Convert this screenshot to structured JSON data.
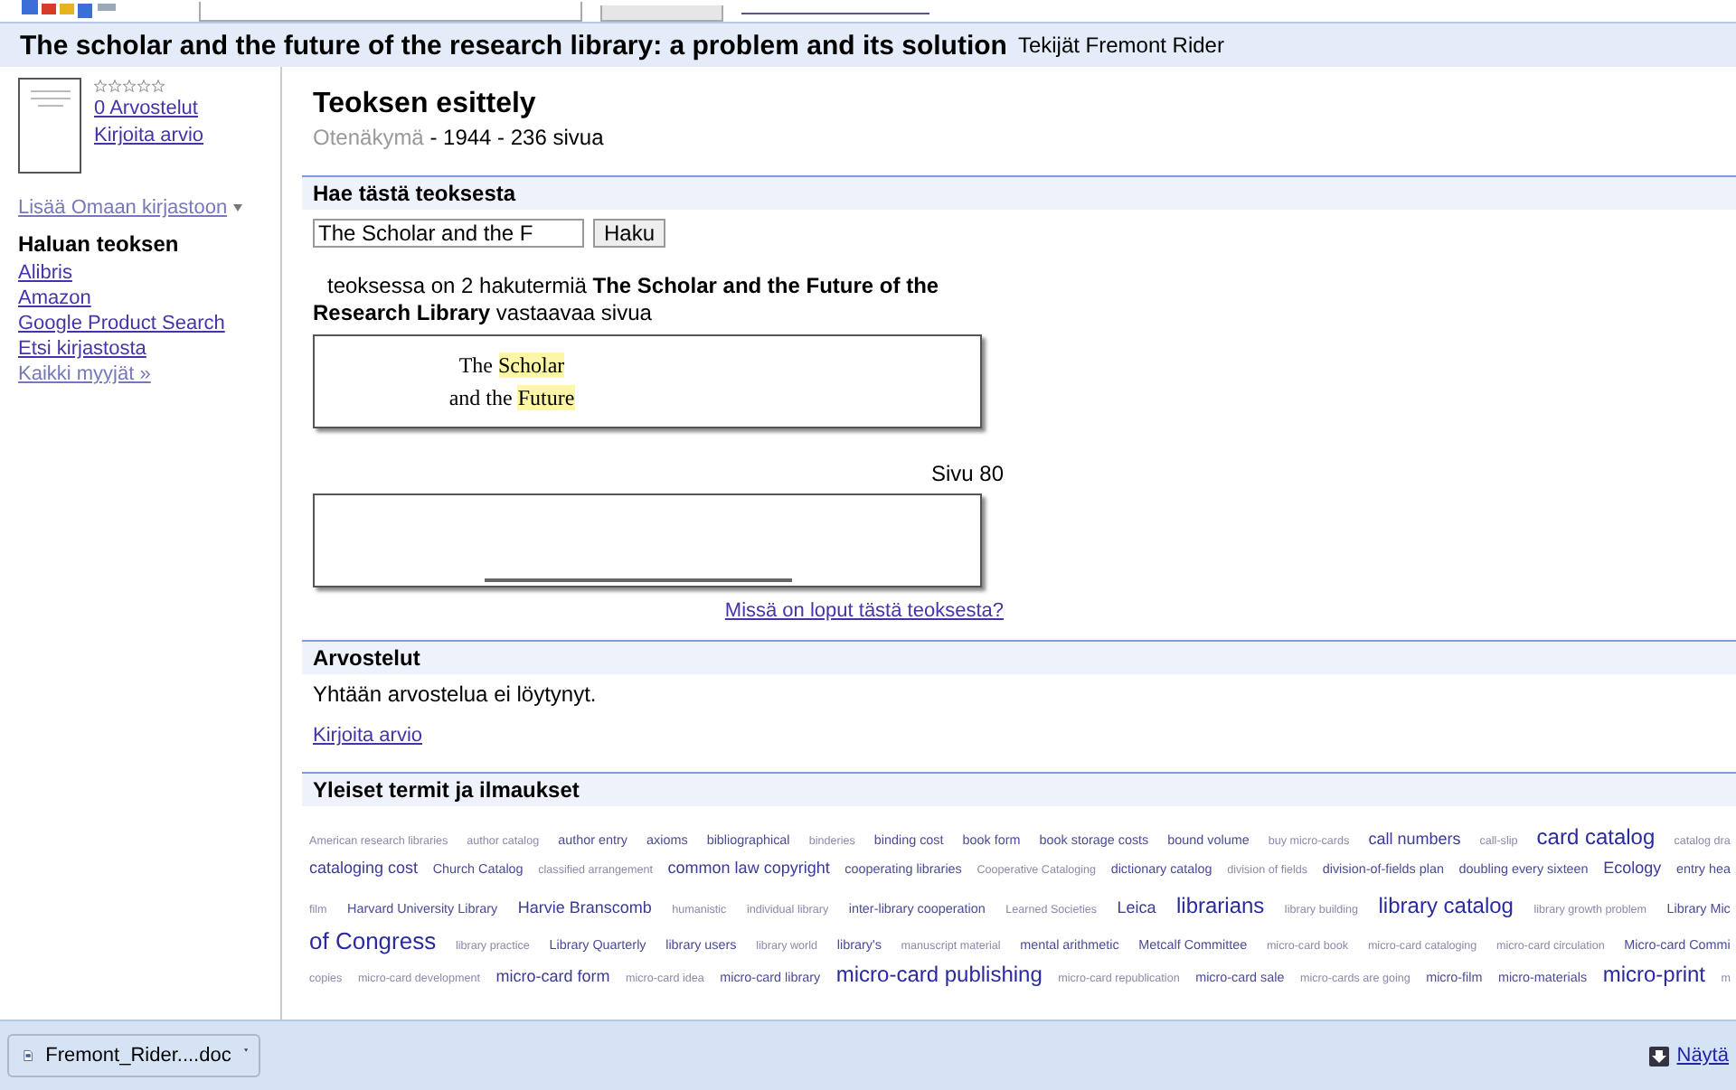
{
  "title": "The scholar and the future of the research library: a problem and its solution",
  "author_line": "Tekijät Fremont Rider",
  "sidebar": {
    "stars": 0,
    "reviews_link": "0 Arvostelut",
    "write_review_link": "Kirjoita arvio",
    "add_library_link": "Lisää Omaan kirjastoon",
    "buy_heading": "Haluan teoksen",
    "buy_links": [
      "Alibris",
      "Amazon",
      "Google Product Search",
      "Etsi kirjastosta"
    ],
    "all_sellers_link": "Kaikki myyjät »"
  },
  "overview": {
    "heading": "Teoksen esittely",
    "view": "Otenäkymä",
    "details": " - 1944 - 236 sivua"
  },
  "search": {
    "heading": "Hae tästä teoksesta",
    "value": "The Scholar and the F",
    "button": "Haku",
    "result": "teoksessa on 2 hakutermiä **The Scholar and the Future of the Research Library** vastaavaa sivua",
    "snippets": [
      {
        "lines": [
          [
            {
              "text": "The ",
              "highlighted": false
            },
            {
              "text": "Scholar",
              "highlighted": true
            }
          ],
          [
            {
              "text": "and the ",
              "highlighted": false
            },
            {
              "text": "Future",
              "highlighted": true
            }
          ]
        ],
        "page": "Sivu 80"
      },
      {
        "kind": "cut"
      }
    ],
    "more_link": "Missä on loput tästä teoksesta?"
  },
  "reviews": {
    "heading": "Arvostelut",
    "empty": "Yhtään arvostelua ei löytynyt.",
    "write_link": "Kirjoita arvio"
  },
  "terms": {
    "heading": "Yleiset termit ja ilmaukset",
    "lines": [
      {
        "terms": [
          {
            "text": "American research libraries",
            "kind": "s"
          },
          {
            "text": "author catalog",
            "kind": "s"
          },
          {
            "text": "author entry",
            "kind": "m"
          },
          {
            "text": "axioms",
            "kind": "m"
          },
          {
            "text": "bibliographical",
            "kind": "m"
          },
          {
            "text": "binderies",
            "kind": "s"
          },
          {
            "text": "binding cost",
            "kind": "m"
          },
          {
            "text": "book form",
            "kind": "m"
          },
          {
            "text": "book storage costs",
            "kind": "m"
          },
          {
            "text": "bound volume",
            "kind": "m"
          },
          {
            "text": "buy micro-cards",
            "kind": "s"
          },
          {
            "text": "call numbers",
            "kind": "l"
          },
          {
            "text": "call-slip",
            "kind": "s"
          },
          {
            "text": "card catalog",
            "kind": "xl"
          },
          {
            "text": "catalog dra",
            "kind": "s"
          }
        ]
      },
      {
        "terms": [
          {
            "text": "cataloging cost",
            "kind": "l"
          },
          {
            "text": "Church Catalog",
            "kind": "m"
          },
          {
            "text": "classified arrangement",
            "kind": "s"
          },
          {
            "text": "common law copyright",
            "kind": "l"
          },
          {
            "text": "cooperating libraries",
            "kind": "m"
          },
          {
            "text": "Cooperative Cataloging",
            "kind": "s"
          },
          {
            "text": "dictionary catalog",
            "kind": "m"
          },
          {
            "text": "division of fields",
            "kind": "s"
          },
          {
            "text": "division-of-fields plan",
            "kind": "m"
          },
          {
            "text": "doubling every sixteen",
            "kind": "m"
          },
          {
            "text": "Ecology",
            "kind": "l"
          },
          {
            "text": "entry hea",
            "kind": "m"
          }
        ]
      },
      {
        "terms": [
          {
            "text": "film",
            "kind": "s"
          },
          {
            "text": "Harvard University Library",
            "kind": "m"
          },
          {
            "text": "Harvie Branscomb",
            "kind": "l"
          },
          {
            "text": "humanistic",
            "kind": "s"
          },
          {
            "text": "individual library",
            "kind": "s"
          },
          {
            "text": "inter-library cooperation",
            "kind": "m"
          },
          {
            "text": "Learned Societies",
            "kind": "s"
          },
          {
            "text": "Leica",
            "kind": "l"
          },
          {
            "text": "librarians",
            "kind": "xl"
          },
          {
            "text": "library building",
            "kind": "s"
          },
          {
            "text": "library catalog",
            "kind": "xl"
          },
          {
            "text": "library growth problem",
            "kind": "s"
          },
          {
            "text": "Library Mic",
            "kind": "m"
          }
        ]
      },
      {
        "terms": [
          {
            "text": "of Congress",
            "kind": "xxl"
          },
          {
            "text": "library practice",
            "kind": "s"
          },
          {
            "text": "Library Quarterly",
            "kind": "m"
          },
          {
            "text": "library users",
            "kind": "m"
          },
          {
            "text": "library world",
            "kind": "s"
          },
          {
            "text": "library's",
            "kind": "m"
          },
          {
            "text": "manuscript material",
            "kind": "s"
          },
          {
            "text": "mental arithmetic",
            "kind": "m"
          },
          {
            "text": "Metcalf Committee",
            "kind": "m"
          },
          {
            "text": "micro-card book",
            "kind": "s"
          },
          {
            "text": "micro-card cataloging",
            "kind": "s"
          },
          {
            "text": "micro-card circulation",
            "kind": "s"
          },
          {
            "text": "Micro-card Commi",
            "kind": "m"
          }
        ]
      },
      {
        "terms": [
          {
            "text": "copies",
            "kind": "s"
          },
          {
            "text": "micro-card development",
            "kind": "s"
          },
          {
            "text": "micro-card form",
            "kind": "l"
          },
          {
            "text": "micro-card idea",
            "kind": "s"
          },
          {
            "text": "micro-card library",
            "kind": "m"
          },
          {
            "text": "micro-card publishing",
            "kind": "xl"
          },
          {
            "text": "micro-card republication",
            "kind": "s"
          },
          {
            "text": "micro-card sale",
            "kind": "m"
          },
          {
            "text": "micro-cards are going",
            "kind": "s"
          },
          {
            "text": "micro-film",
            "kind": "m"
          },
          {
            "text": "micro-materials",
            "kind": "m"
          },
          {
            "text": "micro-print",
            "kind": "xl"
          },
          {
            "text": "m",
            "kind": "s"
          }
        ]
      }
    ]
  },
  "download_bar": {
    "file": "Fremont_Rider....doc",
    "show_all": "Näytä"
  }
}
